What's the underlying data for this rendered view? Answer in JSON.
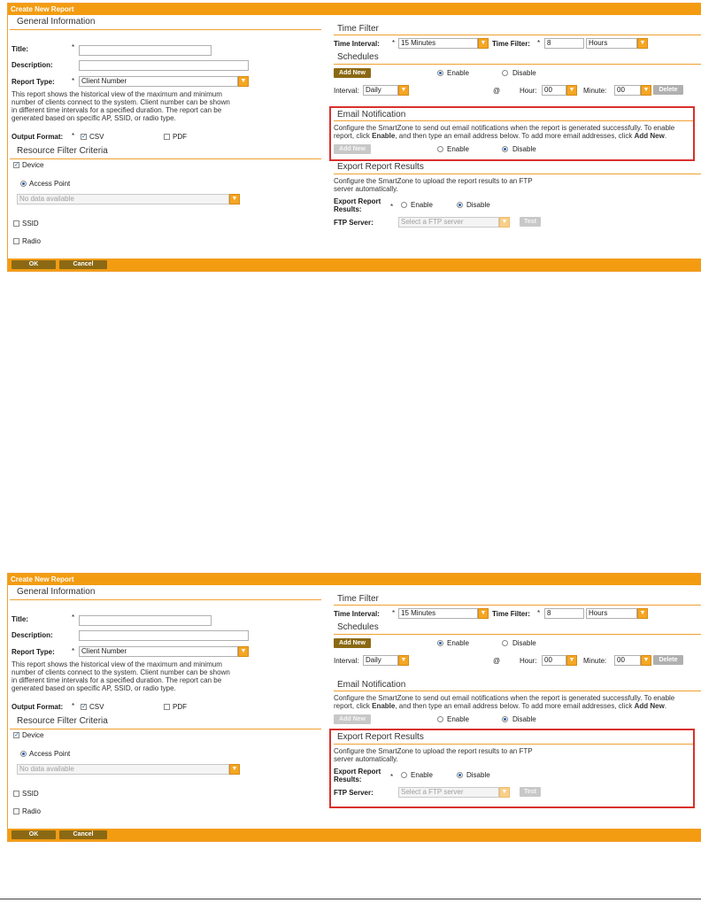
{
  "window_title": "Create New Report",
  "general": {
    "heading": "General Information",
    "title_label": "Title:",
    "description_label": "Description:",
    "report_type_label": "Report Type:",
    "report_type_value": "Client Number",
    "required_mark": "*",
    "report_desc_lines": [
      "This report shows the historical view of the maximum and minimum",
      "number of clients connect to the system. Client number can be shown",
      "in different time intervals for a specified duration. The report can be",
      "generated based on specific AP, SSID, or radio type."
    ],
    "output_format_label": "Output Format:",
    "csv_label": "CSV",
    "pdf_label": "PDF",
    "csv_checked": true,
    "pdf_checked": false
  },
  "resource": {
    "heading": "Resource Filter Criteria",
    "device_label": "Device",
    "access_point_label": "Access Point",
    "ap_select_placeholder": "No data available",
    "ssid_label": "SSID",
    "radio_label": "Radio"
  },
  "time_filter": {
    "heading": "Time Filter",
    "interval_label": "Time Interval:",
    "interval_value": "15 Minutes",
    "filter_label": "Time Filter:",
    "filter_value": "8",
    "unit_value": "Hours"
  },
  "schedules": {
    "heading": "Schedules",
    "add_new": "Add New",
    "enable": "Enable",
    "disable": "Disable",
    "interval_label": "Interval:",
    "interval_value": "Daily",
    "at": "@",
    "hour_label": "Hour:",
    "hour_value": "00",
    "minute_label": "Minute:",
    "minute_value": "00",
    "delete": "Delete"
  },
  "email": {
    "heading": "Email Notification",
    "line1": "Configure the SmartZone to send out email notifications when the report is generated successfully. To enable",
    "line2_a": "report, click ",
    "line2_b": "Enable",
    "line2_c": ", and then type an email address below. To add more email addresses, click ",
    "line2_d": "Add New",
    "line2_e": ".",
    "add_new": "Add New",
    "enable": "Enable",
    "disable": "Disable"
  },
  "export": {
    "heading": "Export Report Results",
    "desc_line1": "Configure the SmartZone to upload the report results to an FTP",
    "desc_line2": "server automatically.",
    "results_label_1": "Export Report",
    "results_label_2": "Results:",
    "enable": "Enable",
    "disable": "Disable",
    "ftp_label": "FTP Server:",
    "ftp_placeholder": "Select a FTP server",
    "test": "Test"
  },
  "footer": {
    "ok": "OK",
    "cancel": "Cancel"
  },
  "colors": {
    "accent": "#f39c12",
    "button": "#8b6914",
    "highlight": "#d9302c"
  }
}
